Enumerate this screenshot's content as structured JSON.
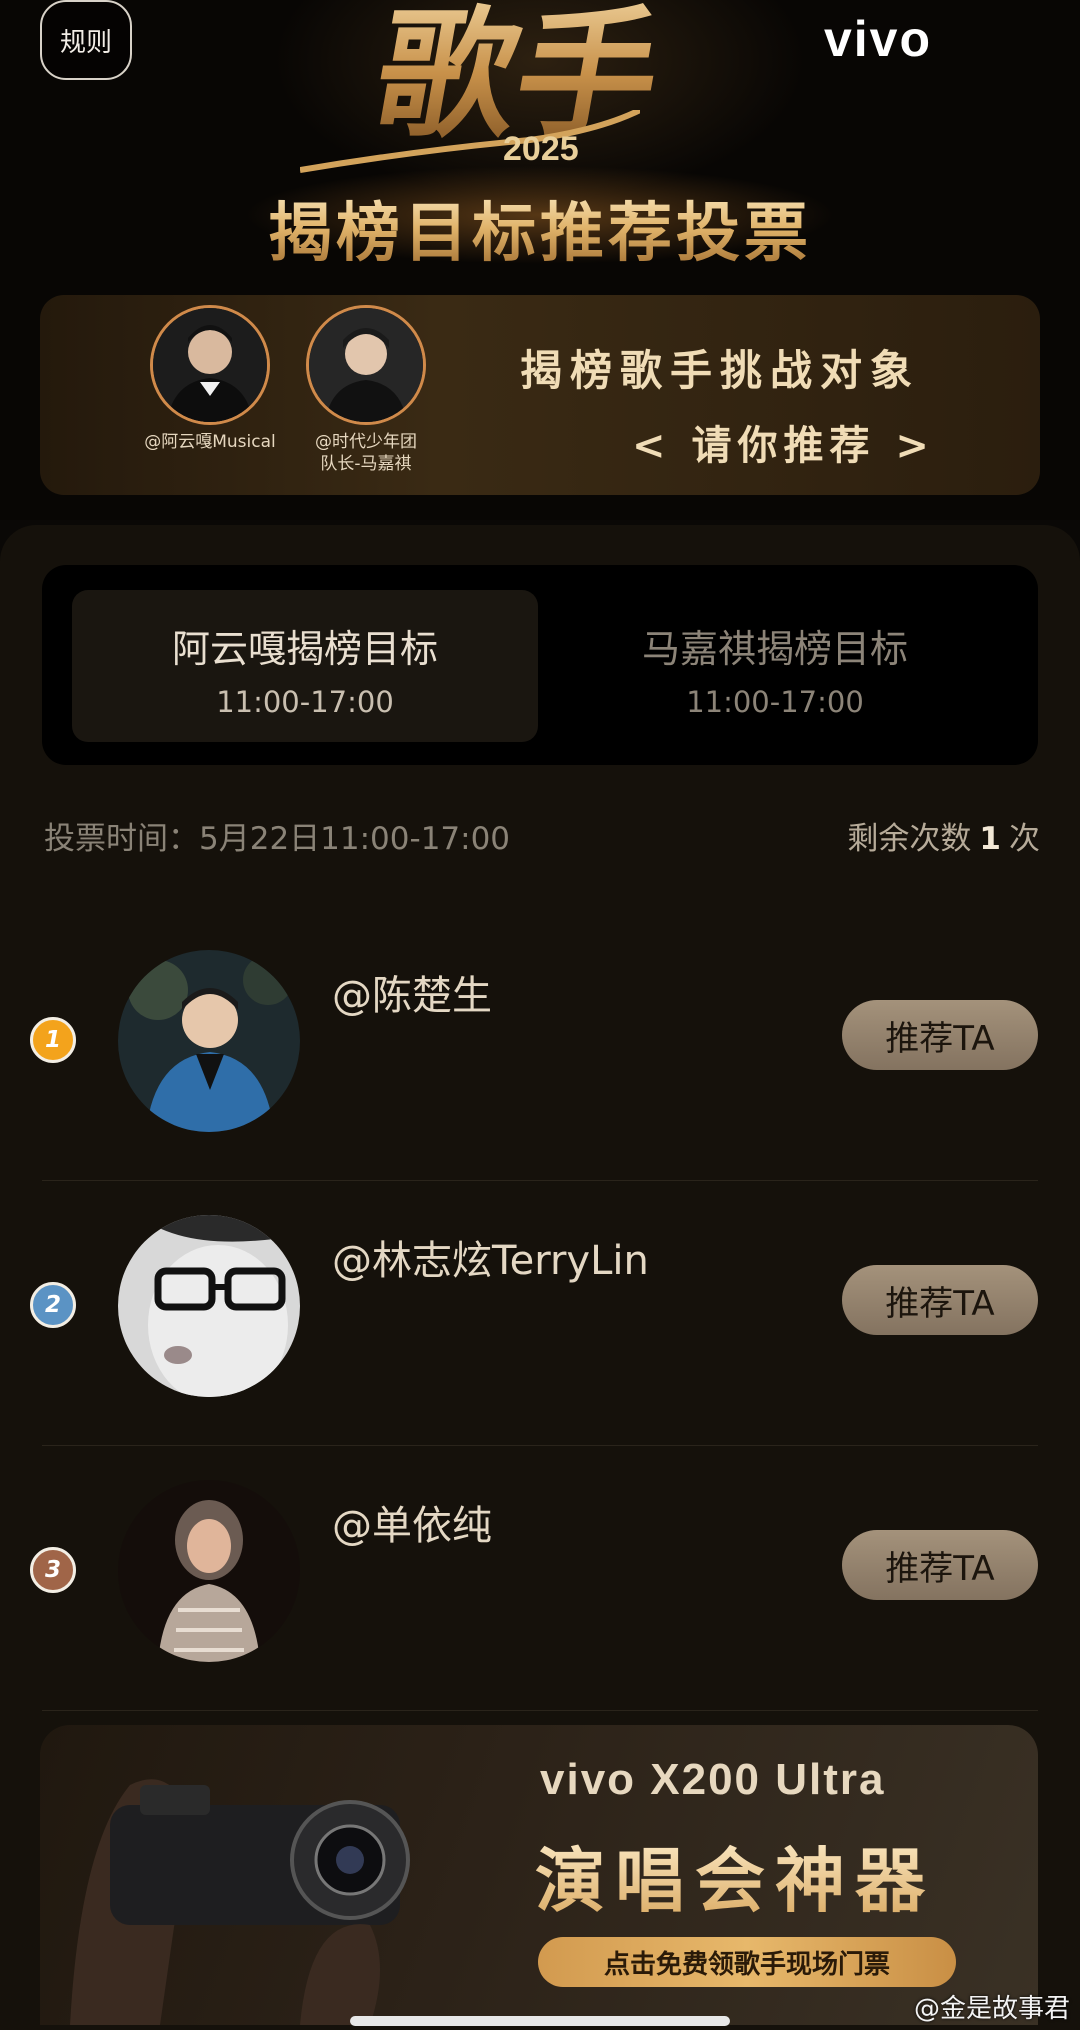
{
  "header": {
    "rules_label": "规则",
    "brand": "vivo",
    "show_logo": "歌手",
    "show_year": "2025",
    "event_title": "揭榜目标推荐投票"
  },
  "banner": {
    "hosts": [
      {
        "name_line1": "@阿云嘎Musical",
        "name_line2": ""
      },
      {
        "name_line1": "@时代少年团",
        "name_line2": "队长-马嘉祺"
      }
    ],
    "title": "揭榜歌手挑战对象",
    "subtitle": "< 请你推荐 >"
  },
  "tabs": [
    {
      "title": "阿云嘎揭榜目标",
      "time": "11:00-17:00",
      "selected": true
    },
    {
      "title": "马嘉祺揭榜目标",
      "time": "11:00-17:00",
      "selected": false
    }
  ],
  "vote_info": {
    "vote_time": "投票时间：5月22日11:00-17:00",
    "remaining_prefix": "剩余次数",
    "remaining_count": "1",
    "remaining_suffix": "次"
  },
  "candidates": [
    {
      "rank": "1",
      "name": "@陈楚生",
      "button": "推荐TA",
      "badge_color": "#f3a31c"
    },
    {
      "rank": "2",
      "name": "@林志炫TerryLin",
      "button": "推荐TA",
      "badge_color": "#5b93c4"
    },
    {
      "rank": "3",
      "name": "@单依纯",
      "button": "推荐TA",
      "badge_color": "#a06548"
    }
  ],
  "promo": {
    "model": "vivo X200 Ultra",
    "slogan": "演唱会神器",
    "cta": "点击免费领歌手现场门票"
  },
  "watermark": "@金是故事君",
  "colors": {
    "gold": "#e0b36a",
    "panel_bg": "#15110b",
    "button_bg": "#9a8770"
  }
}
